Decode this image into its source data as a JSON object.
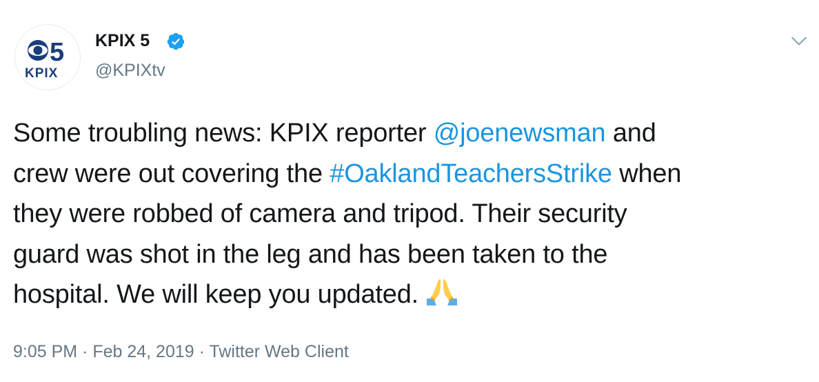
{
  "account": {
    "display_name": "KPIX 5",
    "handle": "@KPIXtv",
    "verified_icon": "verified-badge-icon",
    "avatar_logo_number": "5",
    "avatar_logo_text": "KPIX"
  },
  "tweet": {
    "line1_pre": "Some troubling news: KPIX reporter ",
    "mention": "@joenewsman",
    "line1_post": " and",
    "line2_pre": "crew were out covering the ",
    "hashtag": "#OaklandTeachersStrike",
    "line2_post": " when",
    "line3": "they were robbed of camera and tripod. Their security",
    "line4": "guard was shot in the leg and has been taken to the",
    "line5": "hospital. We will keep you updated.",
    "emoji": "folded-hands-emoji"
  },
  "meta": {
    "time": "9:05 PM",
    "separator": " · ",
    "date": "Feb 24, 2019",
    "source": "Twitter Web Client"
  },
  "colors": {
    "link": "#1b95e0",
    "verified": "#1da1f2",
    "secondary_text": "#657786",
    "primary_text": "#14171a"
  },
  "icons": {
    "caret": "chevron-down-icon"
  }
}
